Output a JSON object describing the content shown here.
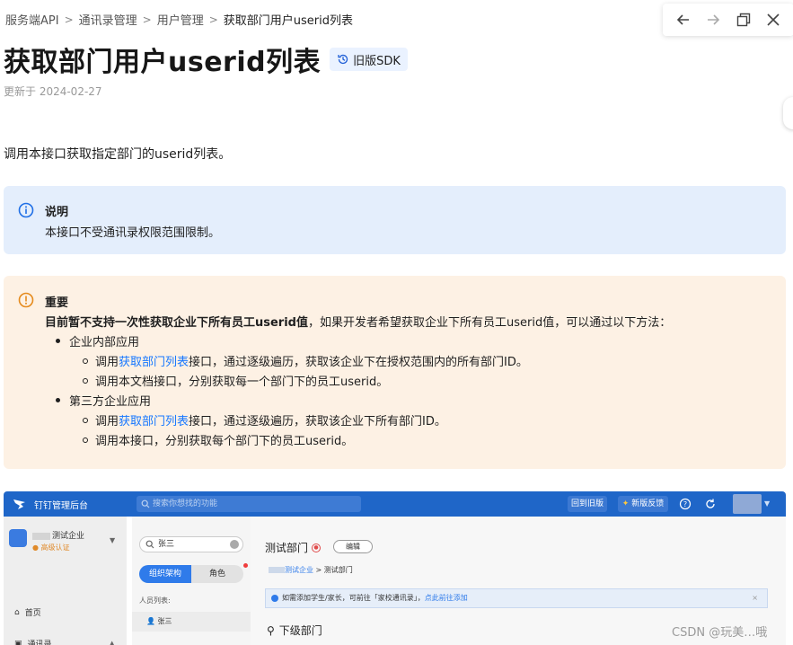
{
  "breadcrumb": [
    "服务端API",
    "通讯录管理",
    "用户管理",
    "获取部门用户userid列表"
  ],
  "title": "获取部门用户userid列表",
  "sdk_badge": "旧版SDK",
  "updated": "更新于 2024-02-27",
  "intro": "调用本接口获取指定部门的userid列表。",
  "note": {
    "heading": "说明",
    "body": "本接口不受通讯录权限范围限制。"
  },
  "important": {
    "heading": "重要",
    "lead_bold": "目前暂不支持一次性获取企业下所有员工userid值",
    "lead_rest": "，如果开发者希望获取企业下所有员工userid值，可以通过以下方法：",
    "groups": [
      {
        "label": "企业内部应用",
        "items": [
          {
            "prefix": "调用",
            "link": "获取部门列表",
            "suffix": "接口，通过逐级遍历，获取该企业下在授权范围内的所有部门ID。"
          },
          {
            "prefix": "调用本文档接口，分别获取每一个部门下的员工userid。",
            "link": "",
            "suffix": ""
          }
        ]
      },
      {
        "label": "第三方企业应用",
        "items": [
          {
            "prefix": "调用",
            "link": "获取部门列表",
            "suffix": "接口，通过逐级遍历，获取该企业下所有部门ID。"
          },
          {
            "prefix": "调用本接口，分别获取每个部门下的员工userid。",
            "link": "",
            "suffix": ""
          }
        ]
      }
    ]
  },
  "screenshot": {
    "app_title": "钉钉管理后台",
    "search_placeholder": "搜索你想找的功能",
    "btn_old": "回到旧版",
    "btn_new": "新版反馈",
    "org_name": "测试企业",
    "org_cert": "高级认证",
    "menu_home": "首页",
    "menu_contacts": "通讯录",
    "search_value": "张三",
    "tab_org": "组织架构",
    "tab_role": "角色",
    "members_label": "人员列表:",
    "member_name": "张三",
    "dept_title": "测试部门",
    "edit_button": "编辑",
    "crumb_company": "测试企业",
    "crumb_dept": "测试部门",
    "info_text": "如需添加学生/家长，可前往「家校通讯录」，",
    "info_link": "点此前往添加",
    "sub_dept": "下级部门"
  },
  "watermark": "CSDN @玩美…哦",
  "colors": {
    "link": "#1677ff",
    "note_bg": "#e4eefc",
    "warn_bg": "#fdf1e4",
    "dingtalk_blue": "#1f66c8"
  }
}
